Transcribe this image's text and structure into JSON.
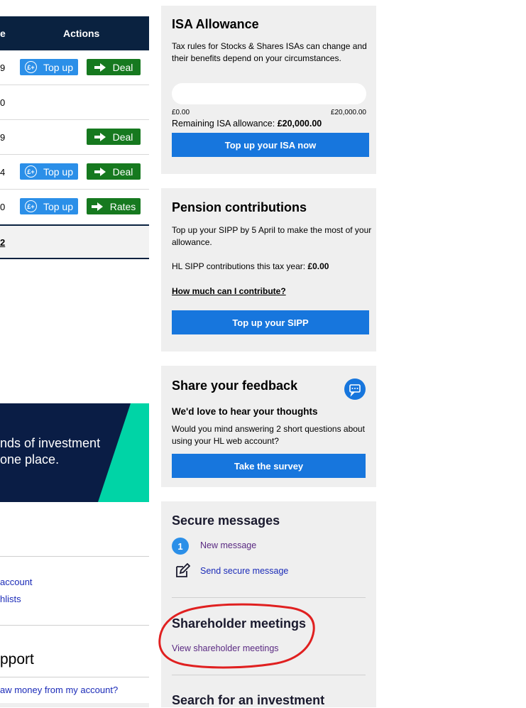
{
  "holdings": {
    "header": {
      "col_partial": "e",
      "actions": "Actions"
    },
    "rows": [
      {
        "value_tail": "9",
        "topup": "Top up",
        "deal": "Deal"
      },
      {
        "value_tail": "0"
      },
      {
        "value_tail": "9",
        "deal": "Deal"
      },
      {
        "value_tail": "4",
        "topup": "Top up",
        "deal": "Deal"
      },
      {
        "value_tail": "0",
        "topup": "Top up",
        "rates": "Rates"
      }
    ],
    "total_tail": "2"
  },
  "promo_banner": {
    "line1": "nds of investment",
    "line2": "one place."
  },
  "left_links": {
    "link1": "account",
    "link2": "hlists"
  },
  "support": {
    "heading": "pport",
    "link": "aw money from my account?"
  },
  "isa": {
    "title": "ISA Allowance",
    "body": "Tax rules for Stocks & Shares ISAs can change and their benefits depend on your circumstances.",
    "min_label": "£0.00",
    "max_label": "£20,000.00",
    "used_fraction": 0,
    "remaining_label": "Remaining ISA allowance: ",
    "remaining_value": "£20,000.00",
    "button": "Top up your ISA now"
  },
  "pension": {
    "title": "Pension contributions",
    "body": "Top up your SIPP by 5 April to make the most of your allowance.",
    "contrib_label": "HL SIPP contributions this tax year: ",
    "contrib_value": "£0.00",
    "link": "How much can I contribute?",
    "button": "Top up your SIPP"
  },
  "feedback": {
    "title": "Share your feedback",
    "subtitle": "We'd love to hear your thoughts",
    "body": "Would you mind answering 2 short questions about using your HL web account?",
    "button": "Take the survey",
    "icon": "chat-icon"
  },
  "messages": {
    "title": "Secure messages",
    "new_count": "1",
    "new_label": "New message",
    "send_label": "Send secure message"
  },
  "shareholder": {
    "title": "Shareholder meetings",
    "link": "View shareholder meetings"
  },
  "search": {
    "title": "Search for an investment"
  },
  "colors": {
    "navy": "#0a2240",
    "blue": "#1776dd",
    "green": "#16791f",
    "teal": "#00d4a6",
    "annotation_red": "#e02020"
  }
}
